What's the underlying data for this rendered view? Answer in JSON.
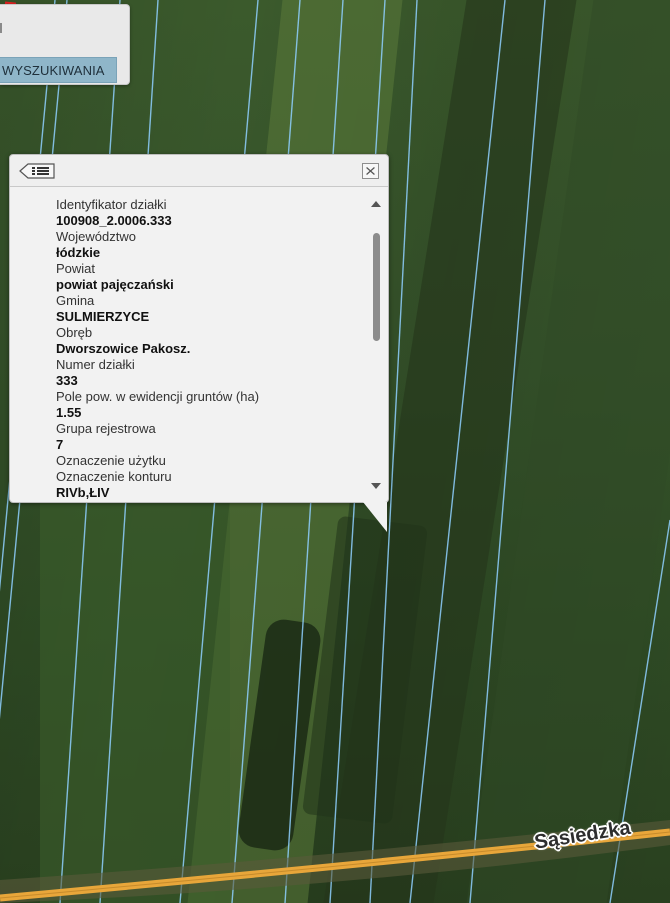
{
  "search": {
    "button_label": "WYSZUKIWANIA"
  },
  "popup": {
    "list_icon": "list-back-icon",
    "close_icon": "close-icon",
    "fields": [
      {
        "label": "Identyfikator działki",
        "value": "100908_2.0006.333"
      },
      {
        "label": "Województwo",
        "value": "łódzkie"
      },
      {
        "label": "Powiat",
        "value": "powiat pajęczański"
      },
      {
        "label": "Gmina",
        "value": "SULMIERZYCE"
      },
      {
        "label": "Obręb",
        "value": "Dworszowice Pakosz."
      },
      {
        "label": "Numer działki",
        "value": "333"
      },
      {
        "label": "Pole pow. w ewidencji gruntów (ha)",
        "value": "1.55"
      },
      {
        "label": "Grupa rejestrowa",
        "value": "7"
      },
      {
        "label": "Oznaczenie użytku",
        "value": ""
      },
      {
        "label": "Oznaczenie konturu",
        "value": "RIVb,ŁIV"
      }
    ]
  },
  "map": {
    "street_name": "Sąsiedzka",
    "colors": {
      "parcel_line": "#8fd0ff",
      "road": "#e8a63a",
      "building_outline": "#e02020"
    }
  }
}
